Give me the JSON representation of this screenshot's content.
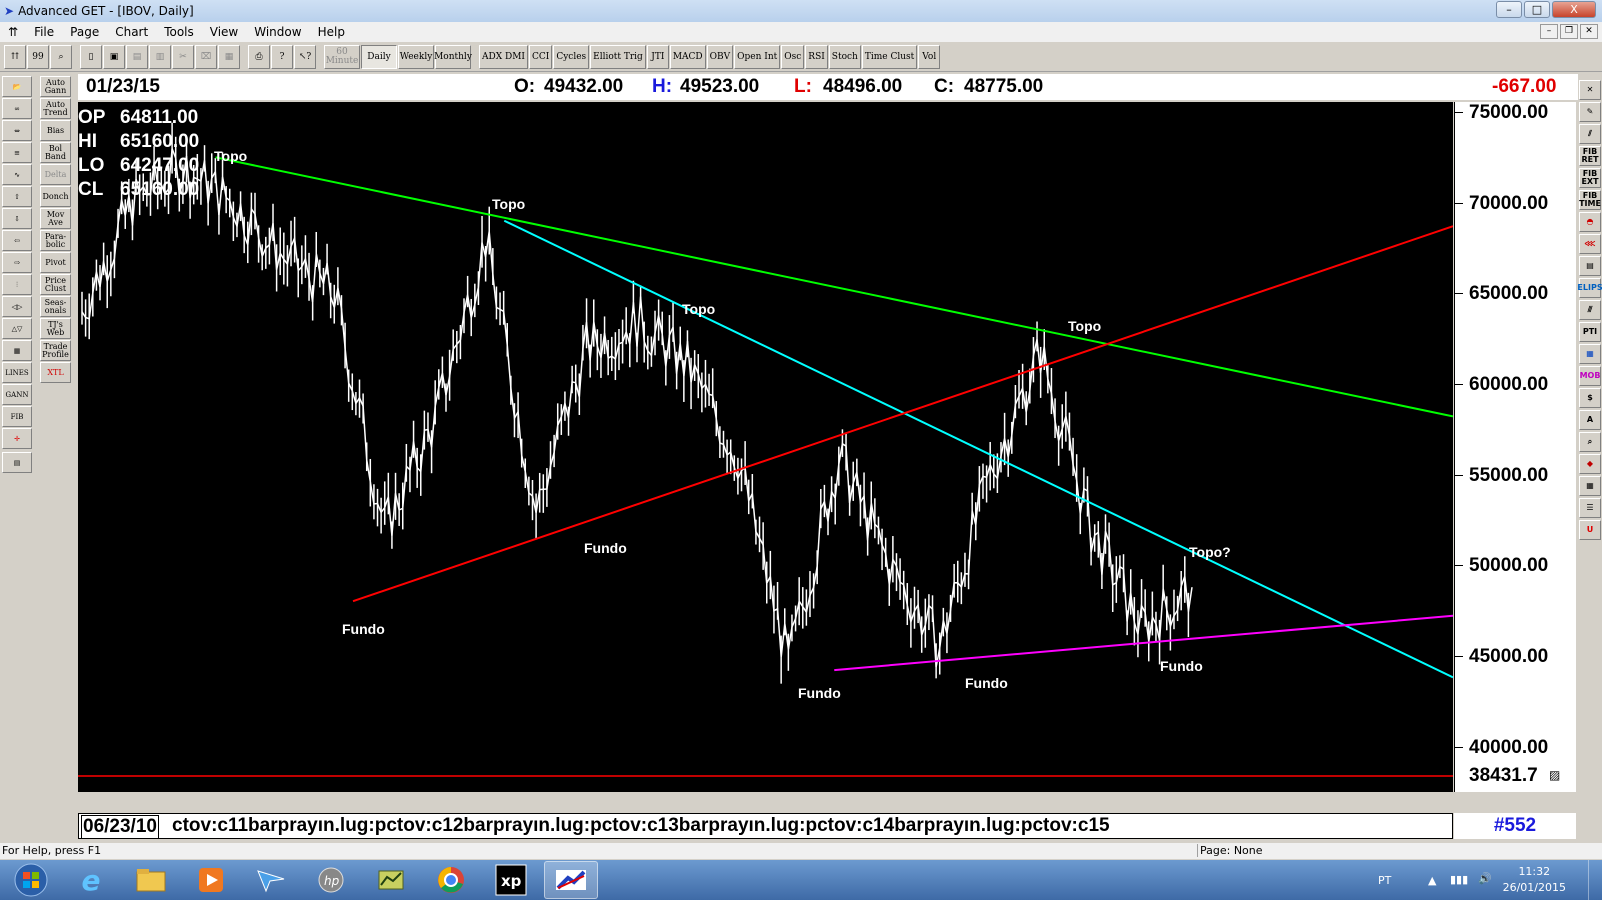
{
  "window": {
    "title": "Advanced GET - [IBOV, Daily]",
    "min": "–",
    "max": "□",
    "close": "X"
  },
  "menu": [
    "File",
    "Page",
    "Chart",
    "Tools",
    "View",
    "Window",
    "Help"
  ],
  "toolbar": {
    "periods": [
      "60 Minute",
      "Daily",
      "Weekly",
      "Monthly"
    ],
    "active_period": "Daily",
    "studies": [
      "ADX DMI",
      "CCI",
      "Cycles",
      "Elliott Trig",
      "JTI",
      "MACD",
      "OBV",
      "Open Int",
      "Osc",
      "RSI",
      "Stoch",
      "Time Clust",
      "Vol"
    ]
  },
  "left_tools_a": [
    "LINES",
    "GANN",
    "FIB"
  ],
  "left_tools_b": [
    "Auto Gann",
    "Auto Trend",
    "Bias",
    "Bol Band",
    "Delta",
    "Donch",
    "Mov Ave",
    "Para-bolic",
    "Pivot",
    "Price Clust",
    "Seas-onals",
    "TJ's Web",
    "Trade Profile",
    "XTL"
  ],
  "right_tools": [
    "FIB RET",
    "FIB EXT",
    "FIB TIME",
    "ELIPS",
    "PTI",
    "MOB",
    "A"
  ],
  "infobar": {
    "date": "01/23/15",
    "o_label": "O:",
    "o": "49432.00",
    "h_label": "H:",
    "h": "49523.00",
    "l_label": "L:",
    "l": "48496.00",
    "c_label": "C:",
    "c": "48775.00",
    "change": "-667.00"
  },
  "ohlc_panel": [
    {
      "k": "OP",
      "v": "64811.00"
    },
    {
      "k": "HI",
      "v": "65160.00"
    },
    {
      "k": "LO",
      "v": "64247.00"
    },
    {
      "k": "CL",
      "v": "65160.00"
    }
  ],
  "yaxis": {
    "labels": [
      "75000.00",
      "70000.00",
      "65000.00",
      "60000.00",
      "55000.00",
      "50000.00",
      "45000.00",
      "40000.00"
    ],
    "bottom": "38431.7"
  },
  "xaxis": {
    "start_date": "06/23/10",
    "ticks": "ctov:c11barprayın.lug:pctov:c12barprayın.lug:pctov:c13barprayın.lug:pctov:c14barprayın.lug:pctov:c15"
  },
  "bar_count": "#552",
  "annotations": {
    "topo1": "Topo",
    "topo2": "Topo",
    "topo3": "Topo",
    "topo4": "Topo",
    "topo5": "Topo?",
    "fundo1": "Fundo",
    "fundo2": "Fundo",
    "fundo3": "Fundo",
    "fundo4": "Fundo",
    "fundo5": "Fundo"
  },
  "chart_data": {
    "type": "line",
    "symbol": "IBOV",
    "timeframe": "Daily",
    "ylim": [
      38431.7,
      76000
    ],
    "x": [
      "2010-06",
      "2010-08",
      "2010-11",
      "2011-01",
      "2011-03",
      "2011-05",
      "2011-08",
      "2011-10",
      "2012-03",
      "2012-06",
      "2012-09",
      "2012-10",
      "2013-01",
      "2013-03",
      "2013-07",
      "2013-10",
      "2013-12",
      "2014-03",
      "2014-06",
      "2014-09",
      "2014-10",
      "2014-12",
      "2015-01"
    ],
    "values": [
      64000,
      70000,
      72000,
      70000,
      67000,
      65000,
      52000,
      58000,
      68000,
      53000,
      62000,
      63500,
      61000,
      56000,
      44500,
      56000,
      50000,
      45500,
      55000,
      61800,
      52000,
      46500,
      48775
    ],
    "trendlines": [
      {
        "color": "#00ff00",
        "from": [
          0.1,
          72500
        ],
        "to": [
          1.0,
          58200
        ]
      },
      {
        "color": "#00ffff",
        "from": [
          0.31,
          69000
        ],
        "to": [
          1.0,
          43800
        ]
      },
      {
        "color": "#ff0000",
        "from": [
          0.2,
          48000
        ],
        "to": [
          1.0,
          68700
        ]
      },
      {
        "color": "#ff00ff",
        "from": [
          0.55,
          44200
        ],
        "to": [
          1.0,
          47200
        ]
      }
    ]
  },
  "statusbar": {
    "help": "For Help, press F1",
    "page": "Page: None"
  },
  "taskbar": {
    "lang": "PT",
    "time": "11:32",
    "date": "26/01/2015"
  }
}
